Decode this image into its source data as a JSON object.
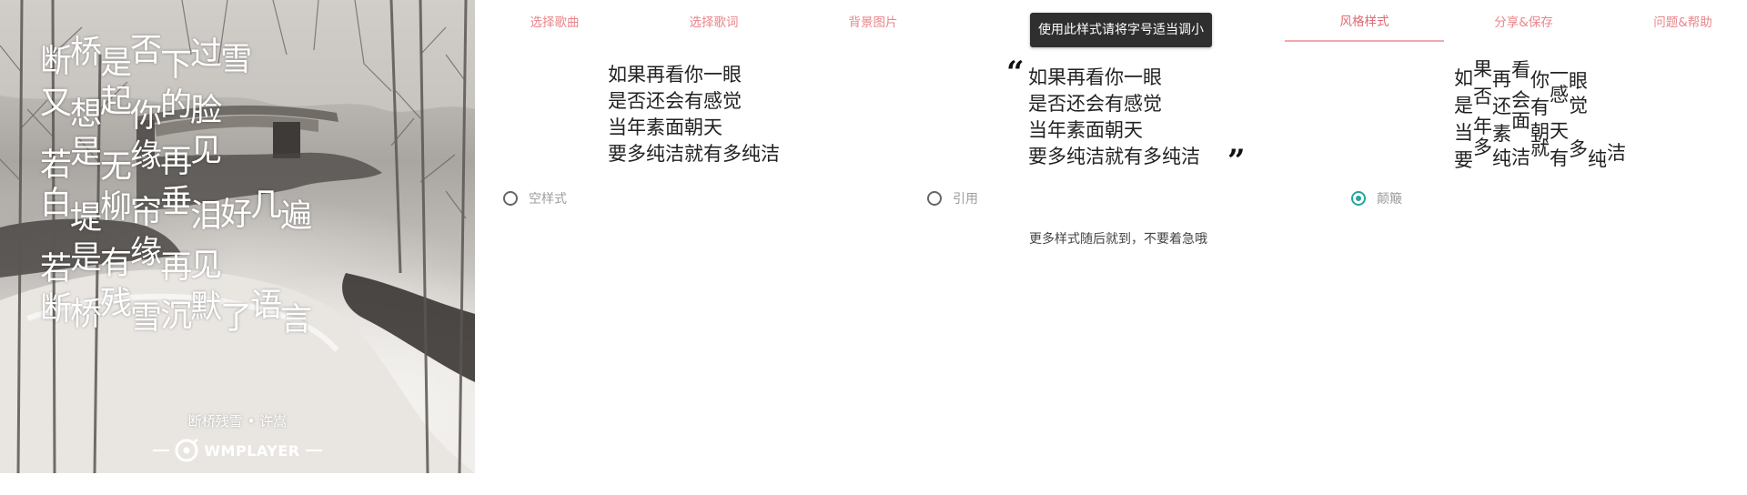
{
  "preview": {
    "lyrics": [
      [
        "断",
        "桥",
        "是",
        "否",
        "下",
        "过",
        "雪"
      ],
      [
        "又",
        "想",
        "起",
        "你",
        "的",
        "脸"
      ],
      [
        "若",
        "是",
        "无",
        "缘",
        "再",
        "见"
      ],
      [
        "白",
        "堤",
        "柳",
        "帘",
        "垂",
        "泪",
        "好",
        "几",
        "遍"
      ],
      [
        "若",
        "是",
        "有",
        "缘",
        "再",
        "见"
      ],
      [
        "断",
        "桥",
        "残",
        "雪",
        "沉",
        "默",
        "了",
        "语",
        "言"
      ]
    ],
    "credit": "断桥残雪 • 许嵩",
    "brand": "WMPLAYER"
  },
  "tabs": [
    {
      "label": "选择歌曲",
      "active": false
    },
    {
      "label": "选择歌词",
      "active": false
    },
    {
      "label": "背景图片",
      "active": false
    },
    {
      "label": "",
      "active": false
    },
    {
      "label": "",
      "active": false
    },
    {
      "label": "风格样式",
      "active": true
    },
    {
      "label": "分享&保存",
      "active": false
    },
    {
      "label": "问题&帮助",
      "active": false
    }
  ],
  "tooltip": "使用此样式请将字号适当调小",
  "samples": {
    "lines": [
      "如果再看你一眼",
      "是否还会有感觉",
      "当年素面朝天",
      "要多纯洁就有多纯洁"
    ],
    "quote_open": "“",
    "quote_close": "”"
  },
  "styles": {
    "plain_label": "空样式",
    "quote_label": "引用",
    "bumpy_label": "颠簸",
    "selected": "bumpy"
  },
  "more_note": "更多样式随后就到，不要着急哦",
  "colors": {
    "accent": "#e06a72",
    "radio_checked": "#26a69a"
  }
}
